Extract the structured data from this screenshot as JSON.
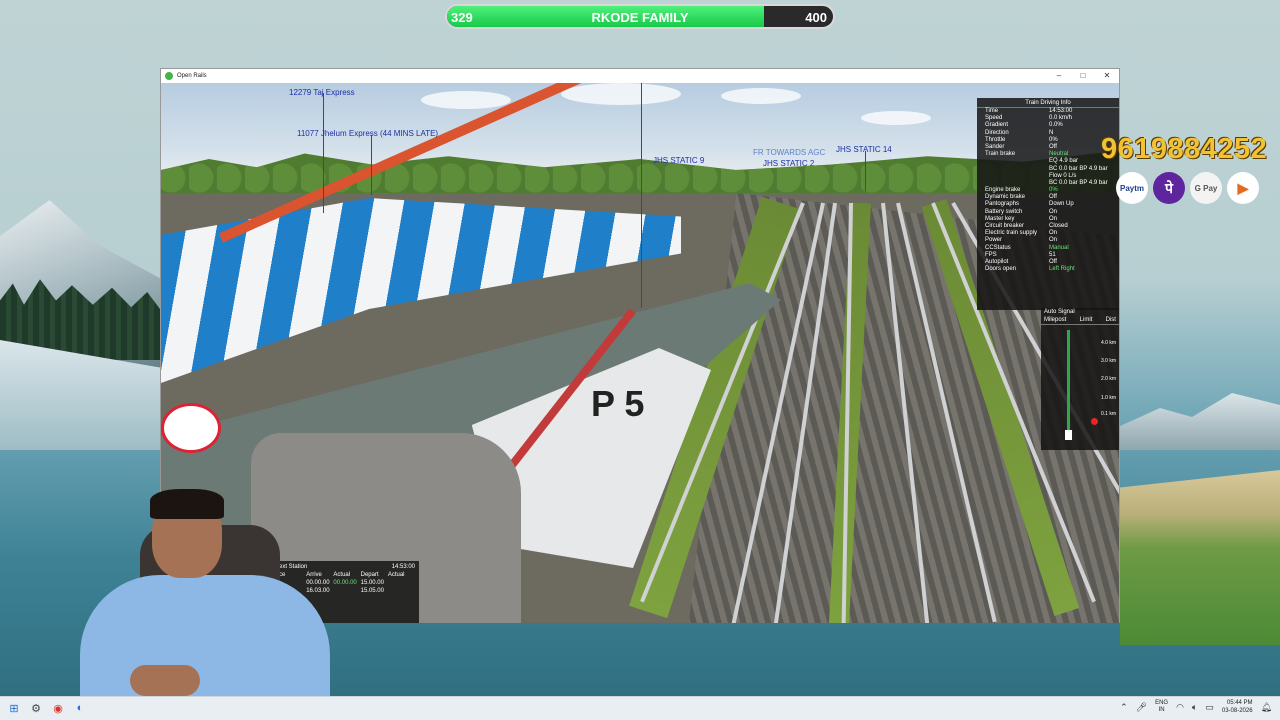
{
  "progress": {
    "left": "329",
    "title": "RKODE FAMILY",
    "right": "400",
    "fraction": 0.82
  },
  "window": {
    "title": "Open Rails",
    "controls": [
      "–",
      "□",
      "✕"
    ]
  },
  "scene_labels": [
    {
      "text": "12279 Taj Express"
    },
    {
      "text": "11077 Jhelum Express (44 MINS LATE)"
    },
    {
      "text": "JHS STATIC 9"
    },
    {
      "text": "FR TOWARDS AGC"
    },
    {
      "text": "JHS STATIC 2"
    },
    {
      "text": "JHS STATIC 14"
    }
  ],
  "driving_info": {
    "title": "Train Driving Info",
    "rows": [
      {
        "k": "Time",
        "v": "14:53:00"
      },
      {
        "k": "Speed",
        "v": "0.0 km/h"
      },
      {
        "k": "Gradient",
        "v": "0.0%"
      },
      {
        "k": "Direction",
        "v": "N"
      },
      {
        "k": "Throttle",
        "v": "0%"
      },
      {
        "k": "Sander",
        "v": "Off"
      },
      {
        "k": "Train brake",
        "v": "Neutral",
        "green": true
      },
      {
        "k": "",
        "v": "EQ 4.9 bar"
      },
      {
        "k": "",
        "v": "BC 0.0 bar BP 4.9 bar"
      },
      {
        "k": "",
        "v": "Flow 0 L/s"
      },
      {
        "k": "",
        "v": "BC 0.0 bar BP 4.9 bar"
      },
      {
        "k": "Engine brake",
        "v": "0%",
        "green": true
      },
      {
        "k": "Dynamic brake",
        "v": "Off"
      },
      {
        "k": "Pantographs",
        "v": "Down Up"
      },
      {
        "k": "Battery switch",
        "v": "On"
      },
      {
        "k": "Master key",
        "v": "On"
      },
      {
        "k": "Circuit breaker",
        "v": "Closed"
      },
      {
        "k": "Electric train supply",
        "v": "On"
      },
      {
        "k": "Power",
        "v": "On"
      },
      {
        "k": "CCStatus",
        "v": "Manual",
        "green": true
      },
      {
        "k": "FPS",
        "v": "51"
      },
      {
        "k": "Autopilot",
        "v": "Off"
      },
      {
        "k": "Doors open",
        "v": "Left Right",
        "green": true
      }
    ]
  },
  "auto_signal": {
    "title": "Auto Signal",
    "headers": [
      "Milepost",
      "Limit",
      "Dist"
    ],
    "distances": [
      "4.0 km",
      "3.0 km",
      "2.0 km",
      "1.0 km",
      "0.1 km"
    ]
  },
  "station_info": {
    "title": "ext Station",
    "time": "14:53:00",
    "headers": [
      "ce",
      "Arrive",
      "Actual",
      "Depart",
      "Actual"
    ],
    "rows": [
      [
        "",
        "00.00.00",
        "00.00.00",
        "15.00.00",
        ""
      ],
      [
        "",
        "16.03.00",
        "",
        "15.05.00",
        ""
      ]
    ]
  },
  "promo": {
    "phone": "9619884252",
    "pay_icons": [
      {
        "name": "paytm-icon",
        "label": "Paytm"
      },
      {
        "name": "phonepe-icon",
        "label": "पे"
      },
      {
        "name": "gpay-icon",
        "label": "G Pay"
      },
      {
        "name": "bhim-icon",
        "label": "▶"
      }
    ]
  },
  "taskbar": {
    "lang_top": "ENG",
    "lang_bottom": "IN",
    "time": "05:44 PM",
    "date": "03-08-2026"
  }
}
